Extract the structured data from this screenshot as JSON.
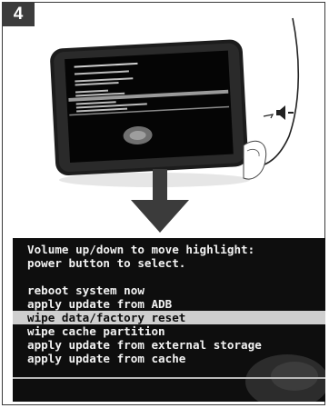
{
  "step": {
    "number": "4"
  },
  "recovery_menu": {
    "header_lines": [
      "Volume up/down to move highlight:",
      "power button to select."
    ],
    "items": [
      "reboot system now",
      "apply update from ADB",
      "wipe data/factory reset",
      "wipe cache partition",
      "apply update from external storage",
      "apply update from cache"
    ],
    "highlighted_index": 2
  },
  "icons": {
    "volume_down": "volume-down-icon",
    "pointer_arrow": "down-arrow-icon"
  },
  "colors": {
    "badge_bg": "#3c3c3c",
    "screen_bg": "#0e0e0e",
    "highlight_bg": "#cfcfcf",
    "menu_text": "#f2f2f2"
  }
}
